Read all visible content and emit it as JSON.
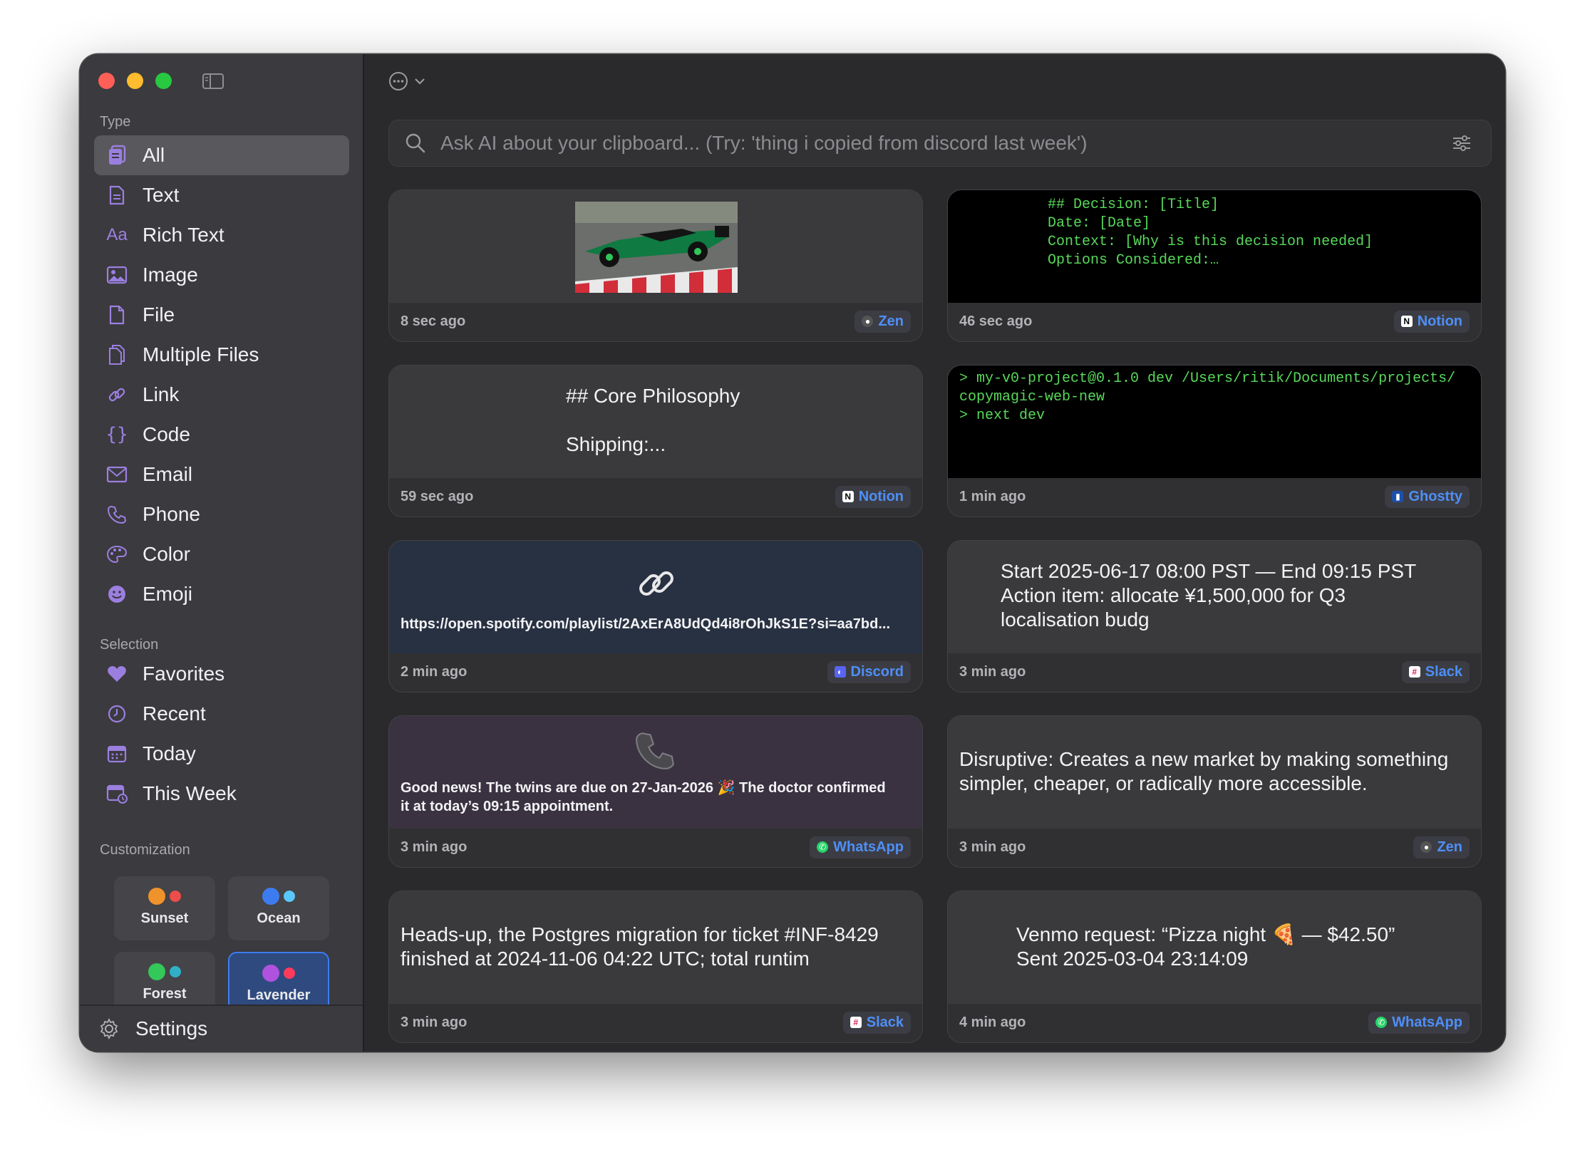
{
  "sidebar": {
    "type_label": "Type",
    "types": [
      {
        "label": "All",
        "icon": "all-icon",
        "active": true
      },
      {
        "label": "Text",
        "icon": "text-icon"
      },
      {
        "label": "Rich Text",
        "icon": "rich-text-icon"
      },
      {
        "label": "Image",
        "icon": "image-icon"
      },
      {
        "label": "File",
        "icon": "file-icon"
      },
      {
        "label": "Multiple Files",
        "icon": "multiple-files-icon"
      },
      {
        "label": "Link",
        "icon": "link-icon"
      },
      {
        "label": "Code",
        "icon": "code-icon"
      },
      {
        "label": "Email",
        "icon": "email-icon"
      },
      {
        "label": "Phone",
        "icon": "phone-icon"
      },
      {
        "label": "Color",
        "icon": "color-palette-icon"
      },
      {
        "label": "Emoji",
        "icon": "emoji-icon"
      }
    ],
    "selection_label": "Selection",
    "selections": [
      {
        "label": "Favorites",
        "icon": "heart-icon"
      },
      {
        "label": "Recent",
        "icon": "clock-icon"
      },
      {
        "label": "Today",
        "icon": "calendar-icon"
      },
      {
        "label": "This Week",
        "icon": "calendar-week-icon"
      }
    ],
    "customization_label": "Customization",
    "themes": [
      {
        "label": "Sunset",
        "c1": "#f0932b",
        "c2": "#eb4d4b"
      },
      {
        "label": "Ocean",
        "c1": "#3d7cf0",
        "c2": "#5ac8fa"
      },
      {
        "label": "Forest",
        "c1": "#34c759",
        "c2": "#30b0c7"
      },
      {
        "label": "Lavender",
        "c1": "#af52de",
        "c2": "#ff3b5c",
        "active": true
      }
    ],
    "settings_label": "Settings"
  },
  "search": {
    "placeholder": "Ask AI about your clipboard... (Try: 'thing i copied from discord last week')"
  },
  "colors": {
    "accent": "#3d7cf0",
    "icon_purple": "#9b7fe0",
    "terminal_green": "#58d85a"
  },
  "cards": [
    {
      "time": "8 sec ago",
      "source": "Zen",
      "source_icon": "zen-icon",
      "kind": "image"
    },
    {
      "time": "46 sec ago",
      "source": "Notion",
      "source_icon": "notion-icon",
      "kind": "code",
      "lines": [
        "## Decision: [Title]",
        "Date: [Date]",
        "Context: [Why is this decision needed]",
        "Options Considered:…"
      ]
    },
    {
      "time": "59 sec ago",
      "source": "Notion",
      "source_icon": "notion-icon",
      "kind": "text",
      "line1": "## Core Philosophy",
      "line2": "Shipping:..."
    },
    {
      "time": "1 min ago",
      "source": "Ghostty",
      "source_icon": "ghostty-icon",
      "kind": "code",
      "lines": [
        "> my-v0-project@0.1.0 dev /Users/ritik/Documents/projects/",
        "copymagic-web-new",
        "> next dev"
      ]
    },
    {
      "time": "2 min ago",
      "source": "Discord",
      "source_icon": "discord-icon",
      "kind": "link",
      "url": "https://open.spotify.com/playlist/2AxErA8UdQd4i8rOhJkS1E?si=aa7bd..."
    },
    {
      "time": "3 min ago",
      "source": "Slack",
      "source_icon": "slack-icon",
      "kind": "text",
      "lines": [
        "Start 2025-06-17 08:00 PST — End 09:15 PST",
        "Action item: allocate ¥1,500,000 for Q3",
        "localisation budg"
      ]
    },
    {
      "time": "3 min ago",
      "source": "WhatsApp",
      "source_icon": "whatsapp-icon",
      "kind": "phone",
      "lines": [
        "Good news! The twins are due on 27-Jan-2026 🎉 The doctor confirmed",
        "it at today’s 09:15 appointment."
      ]
    },
    {
      "time": "3 min ago",
      "source": "Zen",
      "source_icon": "zen-icon",
      "kind": "text",
      "lines": [
        "Disruptive: Creates a new market by making something",
        "simpler, cheaper, or radically more accessible."
      ]
    },
    {
      "time": "3 min ago",
      "source": "Slack",
      "source_icon": "slack-icon",
      "kind": "text",
      "lines": [
        "Heads-up, the Postgres migration for ticket #INF-8429",
        "finished at 2024-11-06 04:22 UTC; total runtim"
      ]
    },
    {
      "time": "4 min ago",
      "source": "WhatsApp",
      "source_icon": "whatsapp-icon",
      "kind": "text",
      "lines": [
        "Venmo request: “Pizza night 🍕 — $42.50”",
        "Sent 2025-03-04 23:14:09"
      ]
    }
  ]
}
